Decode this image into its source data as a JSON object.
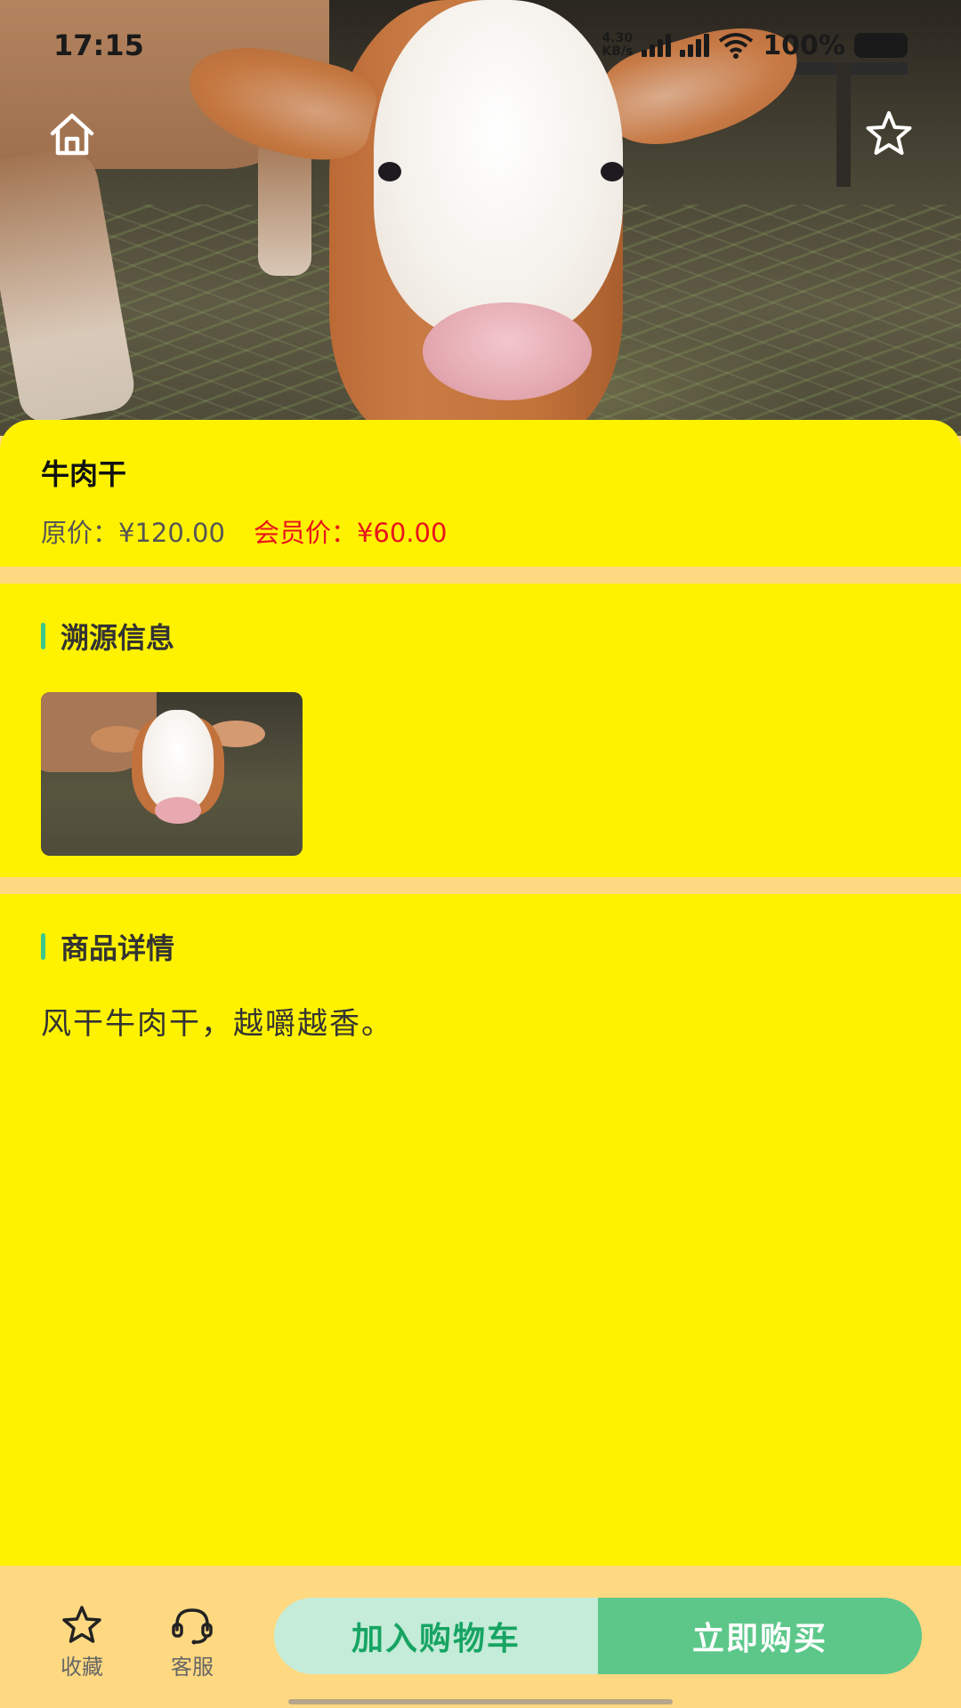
{
  "status_bar": {
    "time": "17:15",
    "speed_value": "4.30",
    "speed_unit": "KB/s",
    "battery": "100%"
  },
  "product": {
    "name": "牛肉干",
    "original_price": "原价：¥120.00",
    "member_price": "会员价：¥60.00"
  },
  "trace": {
    "title": "溯源信息"
  },
  "detail": {
    "title": "商品详情",
    "text": "风干牛肉干，越嚼越香。"
  },
  "bottom_bar": {
    "favorite_label": "收藏",
    "service_label": "客服",
    "add_to_cart": "加入购物车",
    "buy_now": "立即购买"
  },
  "icons": {
    "home": "home-icon",
    "star": "star-icon",
    "headset": "headset-icon"
  },
  "colors": {
    "card_yellow": "#fff200",
    "background": "#ffd981",
    "accent_green": "#3ec88c",
    "buy_green": "#5dc78a",
    "cart_green_bg": "#c4ecd8",
    "member_price_red": "#e8141b"
  }
}
